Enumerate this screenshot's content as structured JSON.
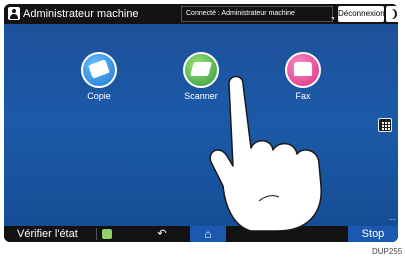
{
  "topbar": {
    "user_name": "Administrateur machine",
    "connection_status": "Connecté : Administrateur machine",
    "logout_label": "Déconnexion"
  },
  "apps": {
    "copy_label": "Copie",
    "scanner_label": "Scanner",
    "fax_label": "Fax"
  },
  "bottombar": {
    "status_label": "Vérifier l'état",
    "back_symbol": "↶",
    "home_symbol": "⌂",
    "stop_label": "Stop"
  },
  "edge_marker": "....",
  "caption": "DUP255",
  "icons": [
    "user-icon",
    "moon-icon",
    "copy-icon",
    "scanner-icon",
    "fax-icon",
    "keypad-icon",
    "status-icon",
    "back-icon",
    "home-icon",
    "hand-pointer-icon"
  ],
  "colors": {
    "screen_bg": "#1b5aa8",
    "bar_bg": "#131313",
    "accent_blue": "#1c58b0",
    "copy": "#1874d2",
    "scanner": "#2e9a3a",
    "fax": "#d52b80"
  }
}
